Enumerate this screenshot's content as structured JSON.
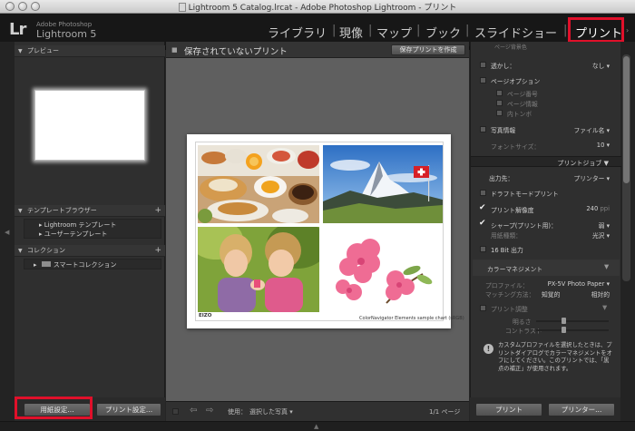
{
  "window": {
    "title": "Lightroom 5 Catalog.lrcat - Adobe Photoshop Lightroom - プリント"
  },
  "identity": {
    "logo": "Lr",
    "company": "Adobe Photoshop",
    "product": "Lightroom 5"
  },
  "modules": {
    "library": "ライブラリ",
    "develop": "現像",
    "map": "マップ",
    "book": "ブック",
    "slideshow": "スライドショー",
    "print": "プリント",
    "separator": "|"
  },
  "left_panel": {
    "preview_header": "プレビュー",
    "template_header": "テンプレートブラウザー",
    "templates": [
      "Lightroom テンプレート",
      "ユーザーテンプレート"
    ],
    "collection_header": "コレクション",
    "collections": [
      "スマートコレクション"
    ],
    "page_setup_button": "用紙設定...",
    "print_settings_button": "プリント設定..."
  },
  "center": {
    "title": "保存されていないプリント",
    "save_button": "保存プリントを作成",
    "page_caption": "ColorNavigator Elements sample chart (sRGB)",
    "page_logo": "EIZO",
    "toolbar": {
      "use_label": "使用：",
      "use_value": "選択した写真",
      "page_count": "1/1 ページ"
    }
  },
  "right_panel": {
    "top_cut": "ページ背景色",
    "watermark_label": "透かし：",
    "watermark_value": "なし",
    "page_options_header": "ページオプション",
    "page_number": "ページ番号",
    "page_info": "ページ情報",
    "crop_marks": "内トンボ",
    "photo_info_label": "写真情報",
    "photo_info_value": "ファイル名",
    "font_size_label": "フォントサイズ：",
    "font_size_value": "10",
    "print_job_header": "プリントジョブ",
    "output_label": "出力先：",
    "output_value": "プリンター",
    "draft_mode": "ドラフトモードプリント",
    "print_resolution": "プリント解像度",
    "print_resolution_value": "240",
    "print_resolution_unit": "ppi",
    "sharpen_label": "シャープ(プリント用)：",
    "sharpen_value": "弱",
    "media_type_label": "用紙種類：",
    "media_type_value": "光沢",
    "sixteen_bit": "16 Bit 出力",
    "color_management_header": "カラーマネジメント",
    "profile_label": "プロファイル：",
    "profile_value": "PX-5V Photo Paper",
    "intent_label": "マッチング方法：",
    "intent_perceptual": "知覚的",
    "intent_relative": "相対的",
    "print_adjust": "プリント調整",
    "brightness_label": "明るさ",
    "contrast_label": "コントラスト",
    "notice": "カスタムプロファイルを選択したときは、プリントダイアログでカラーマネジメントをオフにしてください。このプリントでは、「黒点の補正」が使用されます。",
    "print_button": "プリント",
    "printer_button": "プリンター..."
  },
  "colors": {
    "highlight": "#e0102a",
    "panel": "#2f2f2f",
    "canvas": "#5f5f5f"
  }
}
